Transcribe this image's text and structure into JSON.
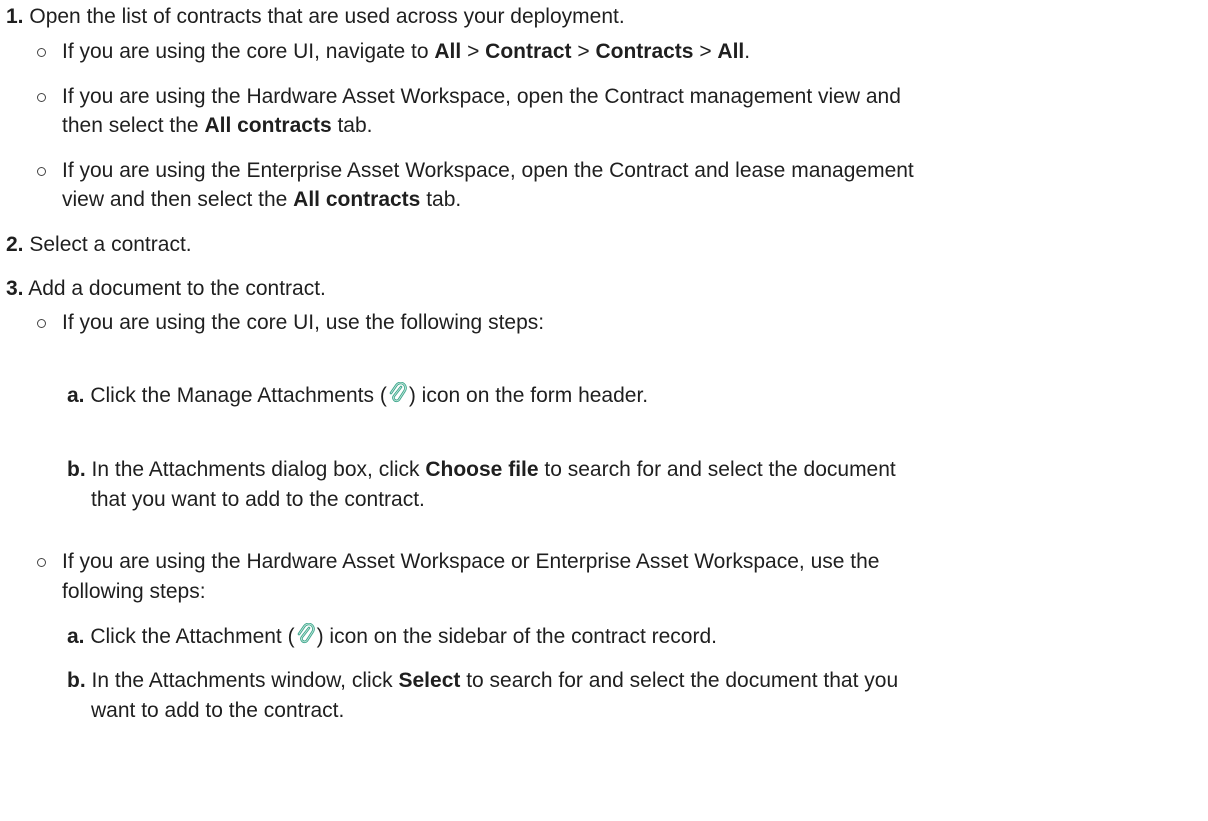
{
  "steps": [
    {
      "number": "1.",
      "text": "Open the list of contracts that are used across your deployment.",
      "bullets": [
        {
          "t1": "If you are using the core UI, navigate to ",
          "b1": "All",
          "s1": " > ",
          "b2": "Contract",
          "s2": " > ",
          "b3": "Contracts",
          "s3": " > ",
          "b4": "All",
          "s4": "."
        },
        {
          "line1": "If you are using the Hardware Asset Workspace, open the Contract management view and",
          "line2_pre": "then select the ",
          "line2_bold": "All contracts",
          "line2_post": " tab."
        },
        {
          "line1": "If you are using the Enterprise Asset Workspace, open the Contract and lease management",
          "line2_pre": "view and then select the ",
          "line2_bold": "All contracts",
          "line2_post": " tab."
        }
      ]
    },
    {
      "number": "2.",
      "text": "Select a contract."
    },
    {
      "number": "3.",
      "text": "Add a document to the contract.",
      "bullets": [
        {
          "text": "If you are using the core UI, use the following steps:",
          "substeps": [
            {
              "letter": "a.",
              "pre": " Click the Manage Attachments (",
              "post": ") icon on the form header."
            },
            {
              "letter": "b.",
              "pre": " In the Attachments dialog box, click ",
              "bold": "Choose file",
              "post": " to search for and select the document",
              "line2": "that you want to add to the contract."
            }
          ]
        },
        {
          "line1": "If you are using the Hardware Asset Workspace or Enterprise Asset Workspace, use the",
          "line2": "following steps:",
          "substeps": [
            {
              "letter": "a.",
              "pre": " Click the Attachment (",
              "post": ") icon on the sidebar of the contract record."
            },
            {
              "letter": "b.",
              "pre": " In the Attachments window, click ",
              "bold": "Select",
              "post": " to search for and select the document that you",
              "line2": "want to add to the contract."
            }
          ]
        }
      ]
    }
  ],
  "icons": {
    "attachment": "paperclip-icon",
    "attachment_color": "#3aa38a"
  }
}
